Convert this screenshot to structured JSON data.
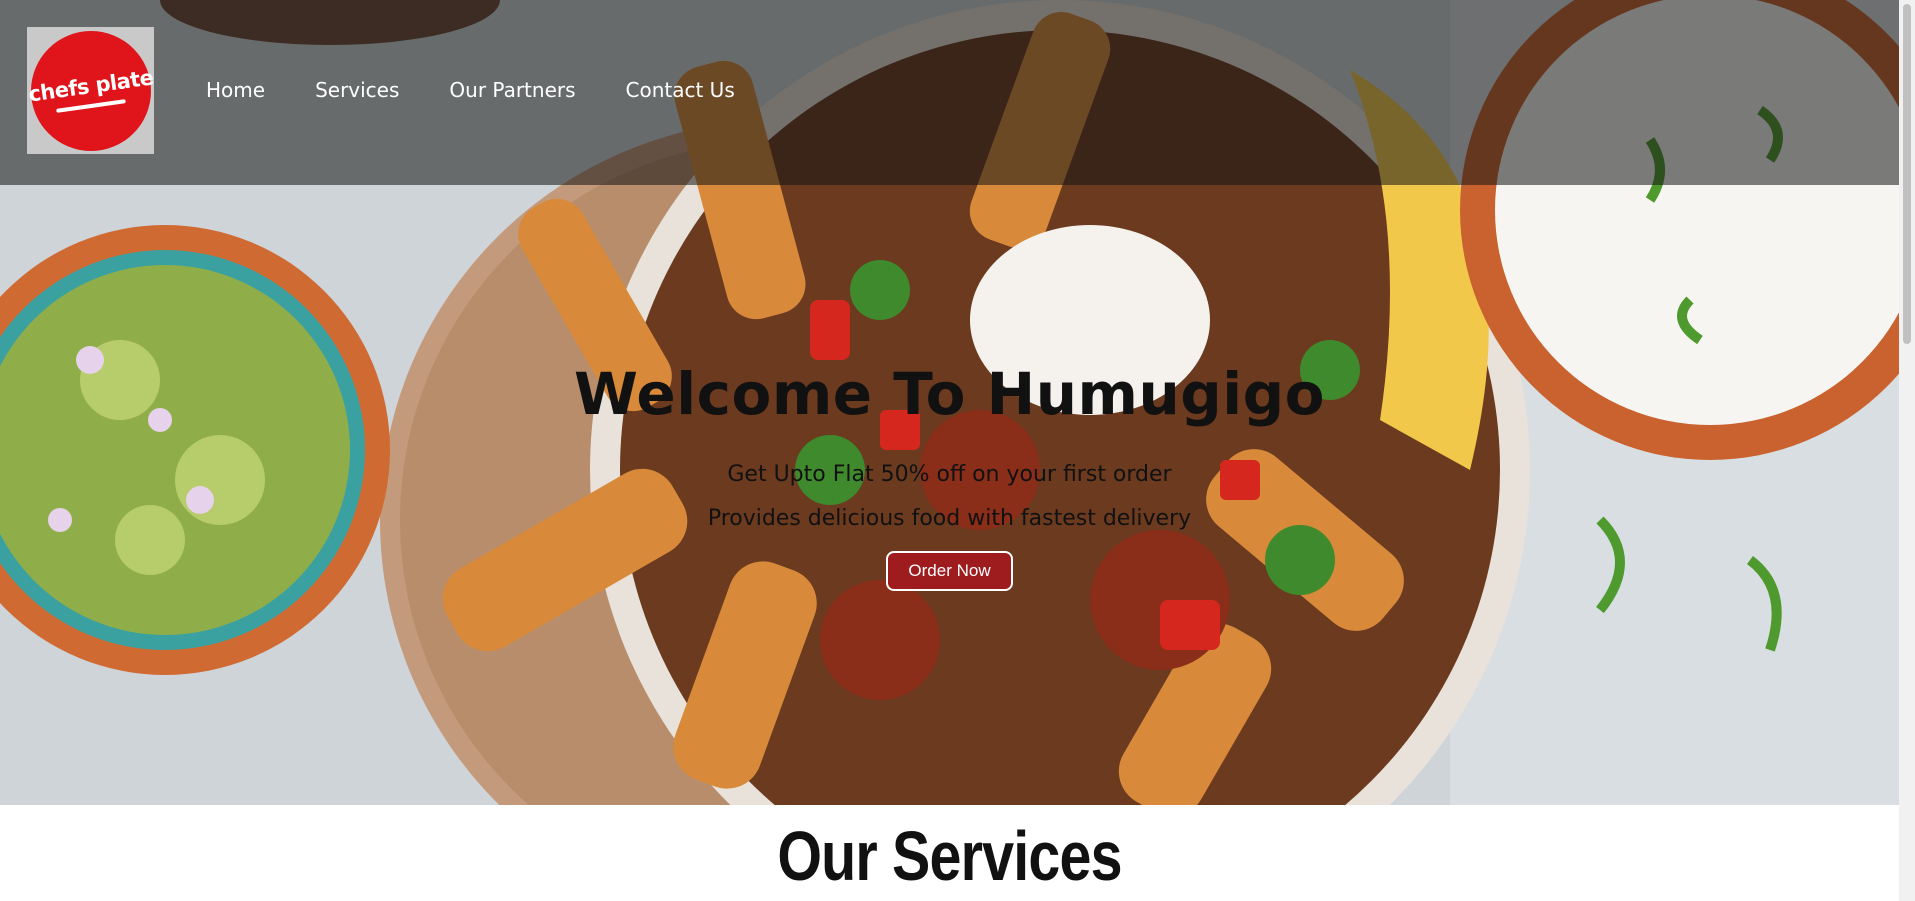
{
  "brand": {
    "logo_text": "chefs plate"
  },
  "nav": {
    "items": [
      {
        "label": "Home"
      },
      {
        "label": "Services"
      },
      {
        "label": "Our Partners"
      },
      {
        "label": "Contact Us"
      }
    ]
  },
  "hero": {
    "title": "Welcome To Humugigo",
    "line1": "Get Upto Flat 50% off on your first order",
    "line2": "Provides delicious food with fastest delivery",
    "cta_label": "Order Now"
  },
  "services": {
    "title": "Our Services"
  },
  "colors": {
    "brand_red": "#e0141b",
    "cta_red": "#9e1b1e"
  },
  "icons": {
    "logo": "chefs-plate-logo"
  }
}
